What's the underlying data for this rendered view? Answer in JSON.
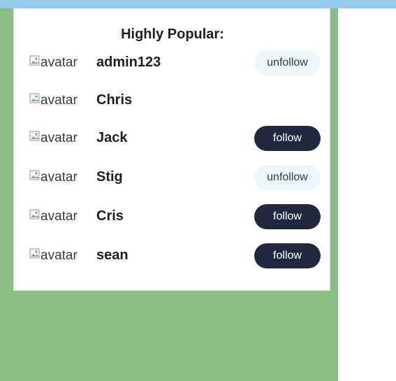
{
  "panel": {
    "title": "Highly Popular:"
  },
  "users": [
    {
      "avatar_alt": "avatar",
      "name": "admin123",
      "action": "unfollow"
    },
    {
      "avatar_alt": "avatar",
      "name": "Chris",
      "action": ""
    },
    {
      "avatar_alt": "avatar",
      "name": "Jack",
      "action": "follow"
    },
    {
      "avatar_alt": "avatar",
      "name": "Stig",
      "action": "unfollow"
    },
    {
      "avatar_alt": "avatar",
      "name": "Cris",
      "action": "follow"
    },
    {
      "avatar_alt": "avatar",
      "name": "sean",
      "action": "follow"
    }
  ],
  "colors": {
    "top_bar": "#93c9ea",
    "green_panel": "#8abf84",
    "follow_button": "#212840",
    "unfollow_button": "#eef6fd"
  }
}
